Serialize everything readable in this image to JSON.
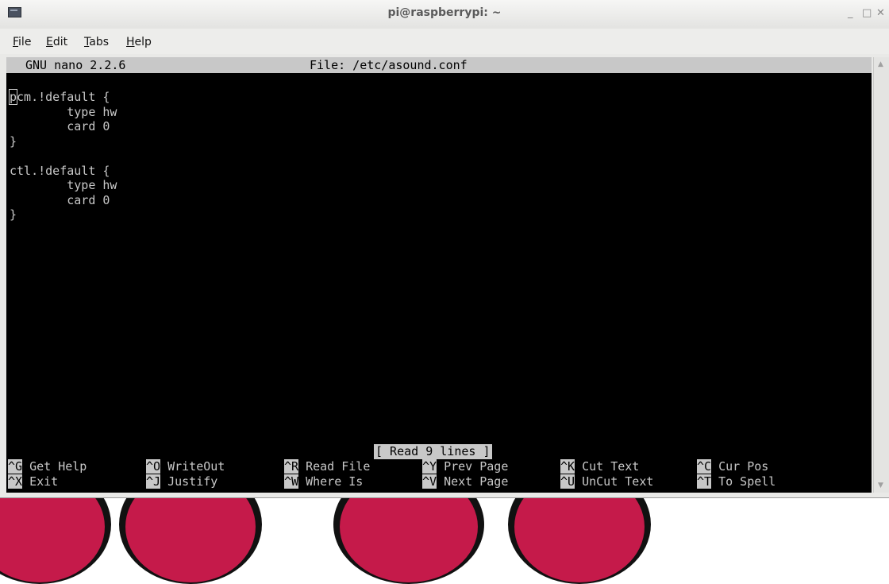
{
  "window": {
    "title": "pi@raspberrypi: ~",
    "controls": [
      "_",
      "□",
      "✕"
    ]
  },
  "menu": [
    {
      "label": "File",
      "accel": "F",
      "rest": "ile"
    },
    {
      "label": "Edit",
      "accel": "E",
      "rest": "dit"
    },
    {
      "label": "Tabs",
      "accel": "T",
      "rest": "abs"
    },
    {
      "label": "Help",
      "accel": "H",
      "rest": "elp"
    }
  ],
  "nano": {
    "version": "GNU nano 2.2.6",
    "file": "File: /etc/asound.conf",
    "lines": [
      "pcm.!default {",
      "        type hw",
      "        card 0",
      "}",
      "",
      "ctl.!default {",
      "        type hw",
      "        card 0",
      "}"
    ],
    "status": "[ Read 9 lines ]",
    "shortcuts_row1": [
      {
        "key": "^G",
        "label": "Get Help"
      },
      {
        "key": "^O",
        "label": "WriteOut"
      },
      {
        "key": "^R",
        "label": "Read File"
      },
      {
        "key": "^Y",
        "label": "Prev Page"
      },
      {
        "key": "^K",
        "label": "Cut Text"
      },
      {
        "key": "^C",
        "label": "Cur Pos"
      }
    ],
    "shortcuts_row2": [
      {
        "key": "^X",
        "label": "Exit"
      },
      {
        "key": "^J",
        "label": "Justify"
      },
      {
        "key": "^W",
        "label": "Where Is"
      },
      {
        "key": "^V",
        "label": "Next Page"
      },
      {
        "key": "^U",
        "label": "UnCut Text"
      },
      {
        "key": "^T",
        "label": "To Spell"
      }
    ]
  },
  "colors": {
    "terminal_bg": "#000000",
    "terminal_fg": "#c8c8c8",
    "raspberry": "#c51a4a"
  }
}
